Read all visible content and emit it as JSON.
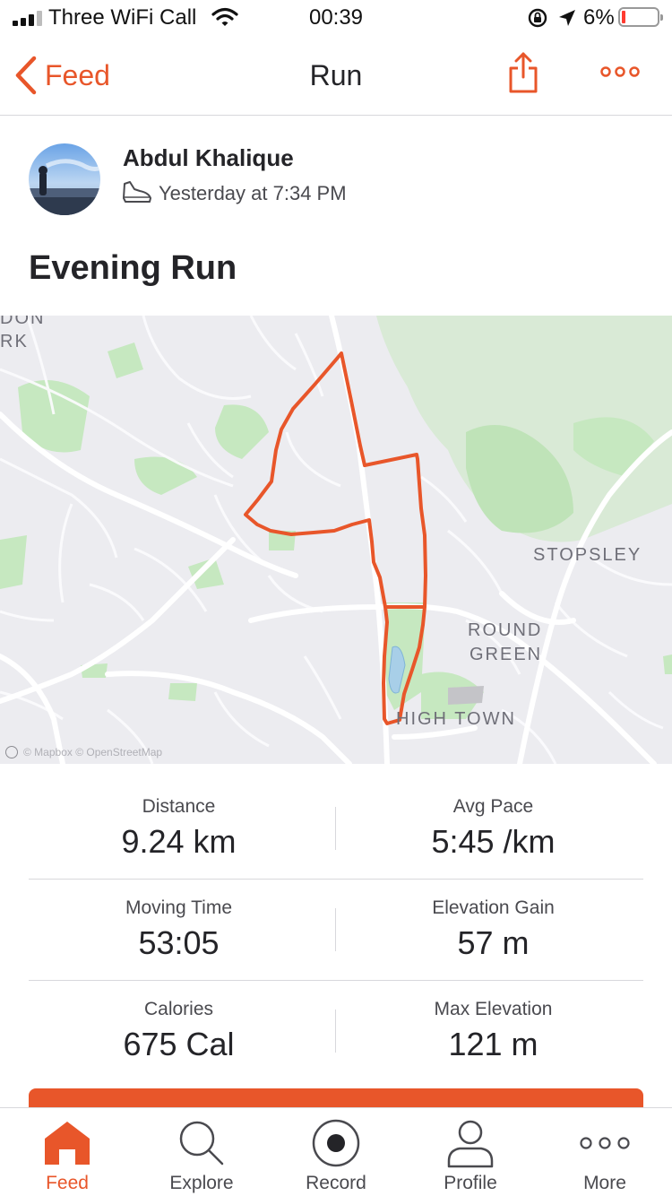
{
  "status_bar": {
    "carrier": "Three WiFi Call",
    "time": "00:39",
    "battery_percent": "6%",
    "battery_level": 0.06,
    "icons": [
      "signal-icon",
      "wifi-icon",
      "rotation-lock-icon",
      "location-icon",
      "battery-icon"
    ]
  },
  "nav": {
    "back_label": "Feed",
    "title": "Run",
    "icons": [
      "back-chevron-icon",
      "share-icon",
      "more-icon"
    ]
  },
  "activity": {
    "athlete_name": "Abdul Khalique",
    "timestamp": "Yesterday at 7:34 PM",
    "title": "Evening Run",
    "activity_icon": "run-shoe-icon"
  },
  "map": {
    "labels": {
      "partial_top_1": "DON",
      "partial_top_2": "RK",
      "stopsley": "STOPSLEY",
      "round": "ROUND",
      "green": "GREEN",
      "high_town": "HIGH TOWN"
    },
    "attribution": "© Mapbox © OpenStreetMap",
    "route_color": "#e8562a"
  },
  "stats": [
    {
      "left_label": "Distance",
      "left_value": "9.24 km",
      "right_label": "Avg Pace",
      "right_value": "5:45 /km"
    },
    {
      "left_label": "Moving Time",
      "left_value": "53:05",
      "right_label": "Elevation Gain",
      "right_value": "57 m"
    },
    {
      "left_label": "Calories",
      "left_value": "675 Cal",
      "right_label": "Max Elevation",
      "right_value": "121 m"
    }
  ],
  "tabs": [
    {
      "label": "Feed",
      "icon": "home-icon",
      "active": true
    },
    {
      "label": "Explore",
      "icon": "search-icon",
      "active": false
    },
    {
      "label": "Record",
      "icon": "record-icon",
      "active": false
    },
    {
      "label": "Profile",
      "icon": "profile-icon",
      "active": false
    },
    {
      "label": "More",
      "icon": "more-icon",
      "active": false
    }
  ],
  "colors": {
    "accent": "#e8562a",
    "text": "#242428",
    "map_bg": "#ececf0",
    "park_green": "#c6e8c0"
  }
}
